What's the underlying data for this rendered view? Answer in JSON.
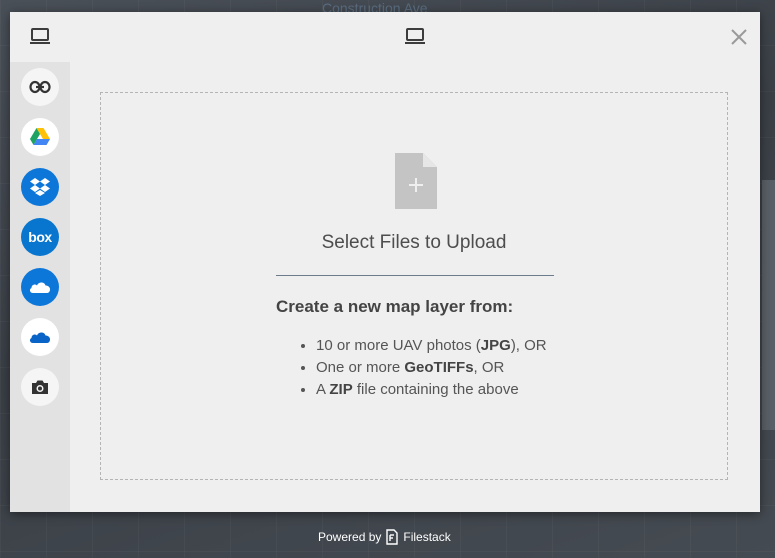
{
  "background": {
    "title": "Construction Ave"
  },
  "modal": {
    "header_left_icon": "computer-icon",
    "header_center_icon": "computer-icon",
    "close_icon": "close-icon"
  },
  "sources": [
    {
      "icon": "link-icon",
      "style": "light"
    },
    {
      "icon": "google-drive-icon",
      "style": "white"
    },
    {
      "icon": "dropbox-icon",
      "style": "blue"
    },
    {
      "icon": "box-icon",
      "style": "box",
      "label": "box"
    },
    {
      "icon": "onedrive-icon",
      "style": "blue"
    },
    {
      "icon": "onedrive-business-icon",
      "style": "white"
    },
    {
      "icon": "camera-icon",
      "style": "light"
    }
  ],
  "dropzone": {
    "title": "Select Files to Upload",
    "heading": "Create a new map layer from:",
    "items": [
      {
        "pre": "10 or more UAV photos (",
        "bold": "JPG",
        "post": "), OR"
      },
      {
        "pre": "One or more ",
        "bold": "GeoTIFFs",
        "post": ", OR"
      },
      {
        "pre": "A ",
        "bold": "ZIP",
        "post": " file containing the above"
      }
    ]
  },
  "footer": {
    "powered_by": "Powered by",
    "brand": "Filestack"
  },
  "colors": {
    "accent_blue": "#0d77d9",
    "modal_bg": "#efefef",
    "sidebar_bg": "#e2e2e2"
  }
}
